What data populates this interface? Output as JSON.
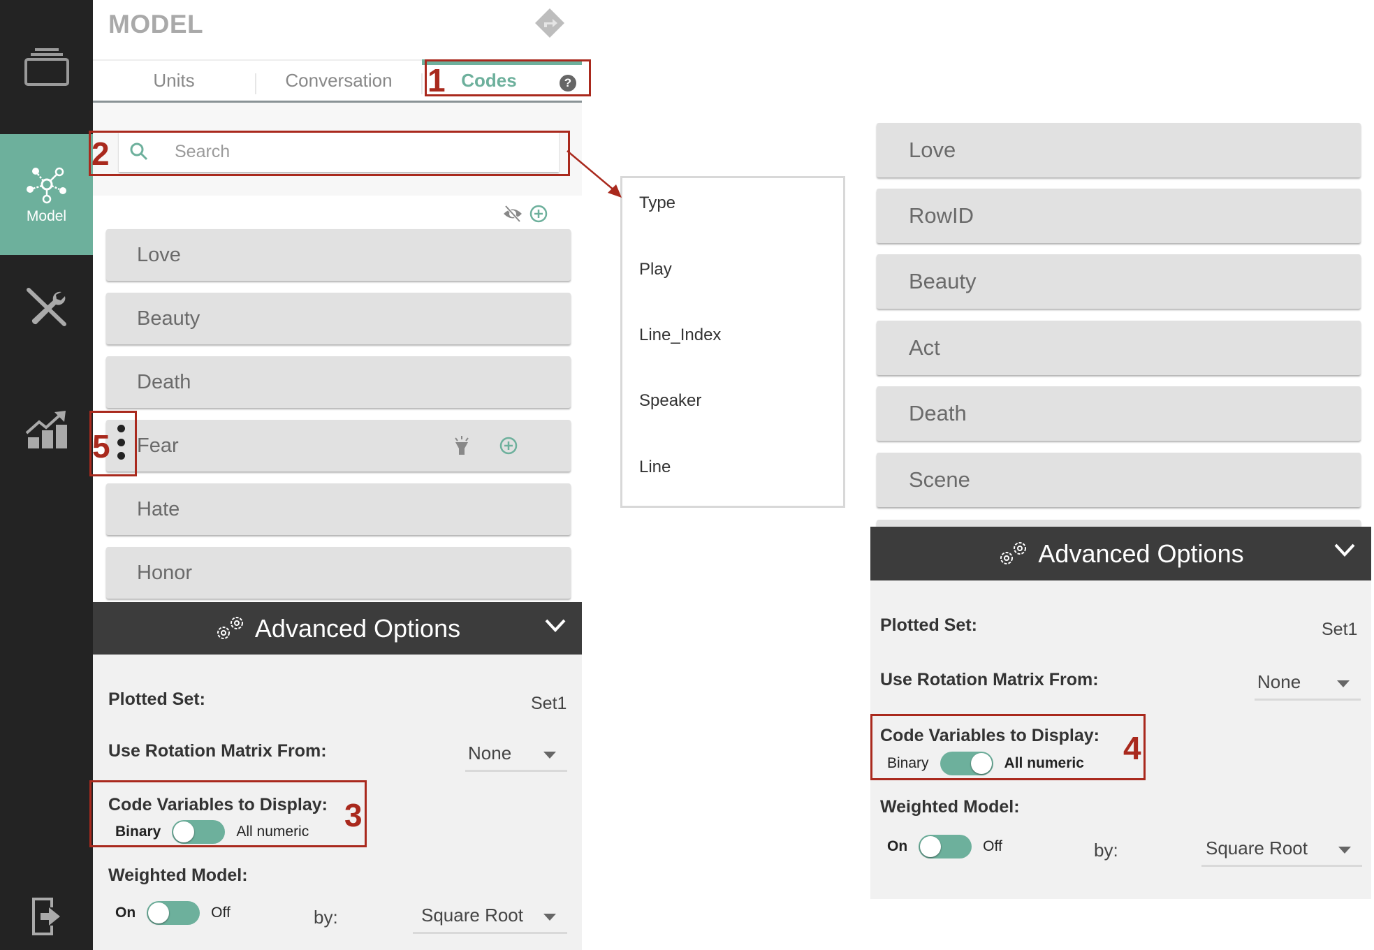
{
  "sidebar": {
    "items": [
      {
        "icon": "stack-icon",
        "label": ""
      },
      {
        "icon": "network-icon",
        "label": "Model",
        "active": true
      },
      {
        "icon": "tools-icon",
        "label": ""
      },
      {
        "icon": "chart-icon",
        "label": ""
      },
      {
        "icon": "exit-icon",
        "label": ""
      }
    ],
    "active_color": "#6db09c"
  },
  "panel": {
    "title": "MODEL",
    "tabs": [
      {
        "label": "Units"
      },
      {
        "label": "Conversation"
      },
      {
        "label": "Codes",
        "active": true
      }
    ],
    "help_glyph": "?",
    "search": {
      "placeholder": "Search",
      "value": ""
    },
    "codes": [
      {
        "name": "Love"
      },
      {
        "name": "Beauty"
      },
      {
        "name": "Death"
      },
      {
        "name": "Fear",
        "hovered": true
      },
      {
        "name": "Hate"
      },
      {
        "name": "Honor"
      }
    ],
    "advanced": {
      "title": "Advanced Options",
      "plotted_set_label": "Plotted Set:",
      "plotted_set_value": "Set1",
      "rotation_label": "Use Rotation Matrix From:",
      "rotation_value": "None",
      "code_vars_label": "Code Variables to Display:",
      "code_vars_left": "Binary",
      "code_vars_right": "All numeric",
      "code_vars_state": "Binary",
      "weighted_label": "Weighted Model:",
      "weighted_on": "On",
      "weighted_off": "Off",
      "weighted_state": "On",
      "by_label": "by:",
      "by_value": "Square Root"
    }
  },
  "variable_dropdown": {
    "items": [
      "Type",
      "Play",
      "Line_Index",
      "Speaker",
      "Line"
    ]
  },
  "right_panel": {
    "codes": [
      {
        "name": "Love"
      },
      {
        "name": "RowID"
      },
      {
        "name": "Beauty"
      },
      {
        "name": "Act"
      },
      {
        "name": "Death"
      },
      {
        "name": "Scene"
      }
    ],
    "advanced": {
      "title": "Advanced Options",
      "plotted_set_label": "Plotted Set:",
      "plotted_set_value": "Set1",
      "rotation_label": "Use Rotation Matrix From:",
      "rotation_value": "None",
      "code_vars_label": "Code Variables to Display:",
      "code_vars_left": "Binary",
      "code_vars_right": "All numeric",
      "code_vars_state": "All numeric",
      "weighted_label": "Weighted Model:",
      "weighted_on": "On",
      "weighted_off": "Off",
      "weighted_state": "On",
      "by_label": "by:",
      "by_value": "Square Root"
    }
  },
  "annotations": [
    "1",
    "2",
    "3",
    "4",
    "5"
  ],
  "colors": {
    "accent": "#6db09c",
    "annotation": "#a9291d",
    "sidebar": "#232323",
    "header": "#3c3c3c"
  }
}
